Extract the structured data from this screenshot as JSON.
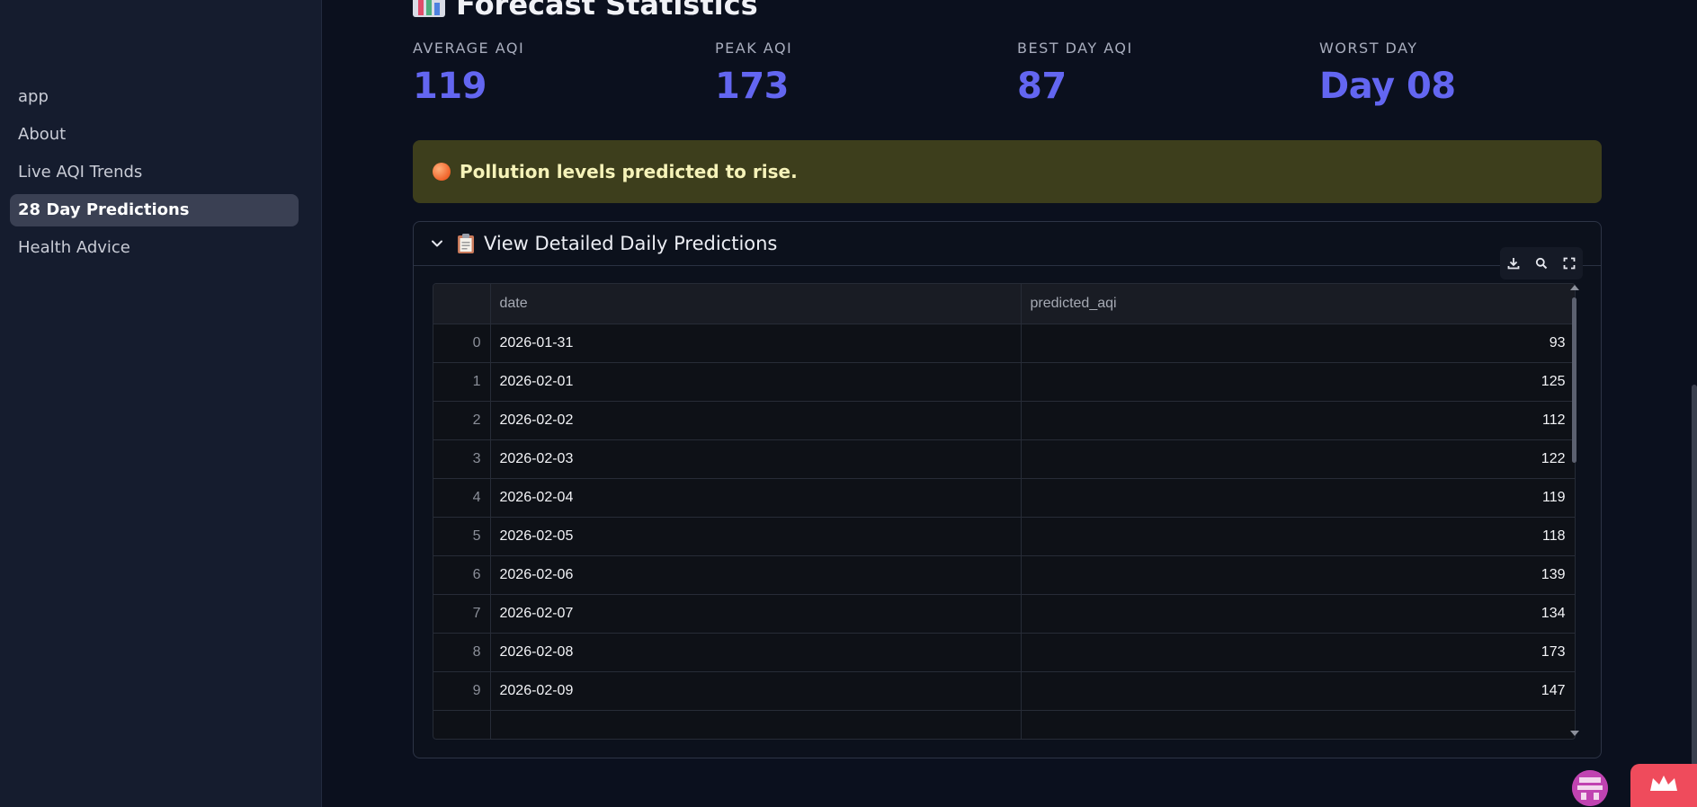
{
  "sidebar": {
    "items": [
      {
        "label": "app",
        "active": false
      },
      {
        "label": "About",
        "active": false
      },
      {
        "label": "Live AQI Trends",
        "active": false
      },
      {
        "label": "28 Day Predictions",
        "active": true
      },
      {
        "label": "Health Advice",
        "active": false
      }
    ]
  },
  "stats": {
    "title": "Forecast Statistics",
    "metrics": [
      {
        "label": "AVERAGE AQI",
        "value": "119"
      },
      {
        "label": "PEAK AQI",
        "value": "173"
      },
      {
        "label": "BEST DAY AQI",
        "value": "87"
      },
      {
        "label": "WORST DAY",
        "value": "Day 08"
      }
    ]
  },
  "alert": {
    "text": "Pollution levels predicted to rise."
  },
  "expander": {
    "label": "View Detailed Daily Predictions"
  },
  "table": {
    "columns": [
      "",
      "date",
      "predicted_aqi"
    ],
    "rows": [
      [
        "0",
        "2026-01-31",
        "93"
      ],
      [
        "1",
        "2026-02-01",
        "125"
      ],
      [
        "2",
        "2026-02-02",
        "112"
      ],
      [
        "3",
        "2026-02-03",
        "122"
      ],
      [
        "4",
        "2026-02-04",
        "119"
      ],
      [
        "5",
        "2026-02-05",
        "118"
      ],
      [
        "6",
        "2026-02-06",
        "139"
      ],
      [
        "7",
        "2026-02-07",
        "134"
      ],
      [
        "8",
        "2026-02-08",
        "173"
      ],
      [
        "9",
        "2026-02-09",
        "147"
      ]
    ]
  },
  "toolbar": {
    "icons": [
      "download-icon",
      "search-icon",
      "fullscreen-icon"
    ]
  },
  "colors": {
    "accent": "#6366f1",
    "alert_bg": "#3d3e1c",
    "alert_text": "#f6f3b9",
    "badge": "#ef4b5c"
  }
}
